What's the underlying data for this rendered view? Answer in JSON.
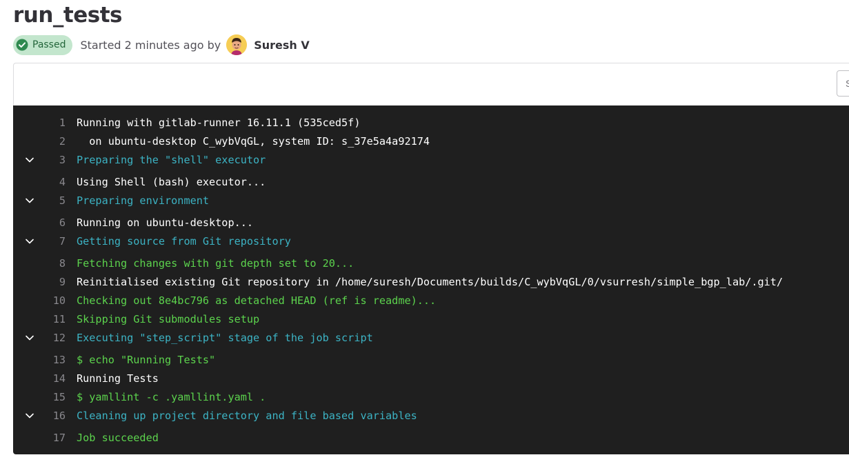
{
  "job": {
    "title": "run_tests",
    "status_label": "Passed",
    "started_text": "Started 2 minutes ago by",
    "author": "Suresh V",
    "panel_button_label": "S"
  },
  "colors": {
    "section_header": "#3cb3c4",
    "success": "#5cd34d",
    "text": "#ffffff",
    "log_background": "#1f1f1f",
    "badge_background": "#c3e6cd"
  },
  "log": [
    {
      "n": "1",
      "text": "Running with gitlab-runner 16.11.1 (535ced5f)",
      "style": "white",
      "collapsible": false
    },
    {
      "n": "2",
      "text": "  on ubuntu-desktop C_wybVqGL, system ID: s_37e5a4a92174",
      "style": "white",
      "collapsible": false
    },
    {
      "n": "3",
      "text": "Preparing the \"shell\" executor",
      "style": "cyan",
      "collapsible": true
    },
    {
      "n": "4",
      "text": "Using Shell (bash) executor...",
      "style": "white",
      "collapsible": false
    },
    {
      "n": "5",
      "text": "Preparing environment",
      "style": "cyan",
      "collapsible": true
    },
    {
      "n": "6",
      "text": "Running on ubuntu-desktop...",
      "style": "white",
      "collapsible": false
    },
    {
      "n": "7",
      "text": "Getting source from Git repository",
      "style": "cyan",
      "collapsible": true
    },
    {
      "n": "8",
      "text": "Fetching changes with git depth set to 20...",
      "style": "green",
      "collapsible": false
    },
    {
      "n": "9",
      "text": "Reinitialised existing Git repository in /home/suresh/Documents/builds/C_wybVqGL/0/vsurresh/simple_bgp_lab/.git/",
      "style": "white",
      "collapsible": false
    },
    {
      "n": "10",
      "text": "Checking out 8e4bc796 as detached HEAD (ref is readme)...",
      "style": "green",
      "collapsible": false
    },
    {
      "n": "11",
      "text": "Skipping Git submodules setup",
      "style": "green",
      "collapsible": false
    },
    {
      "n": "12",
      "text": "Executing \"step_script\" stage of the job script",
      "style": "cyan",
      "collapsible": true
    },
    {
      "n": "13",
      "text": "$ echo \"Running Tests\"",
      "style": "green",
      "collapsible": false
    },
    {
      "n": "14",
      "text": "Running Tests",
      "style": "white",
      "collapsible": false
    },
    {
      "n": "15",
      "text": "$ yamllint -c .yamllint.yaml .",
      "style": "green",
      "collapsible": false
    },
    {
      "n": "16",
      "text": "Cleaning up project directory and file based variables",
      "style": "cyan",
      "collapsible": true
    },
    {
      "n": "17",
      "text": "Job succeeded",
      "style": "green",
      "collapsible": false
    }
  ]
}
